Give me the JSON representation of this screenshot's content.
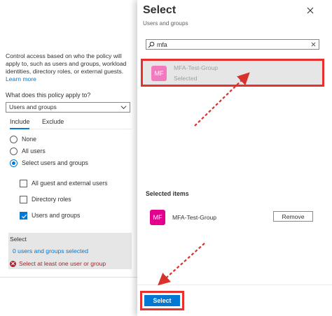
{
  "policy_pane": {
    "description": "Control access based on who the policy will apply to, such as users and groups, workload identities, directory roles, or external guests.",
    "learn_more": "Learn more",
    "question": "What does this policy apply to?",
    "applies_value": "Users and groups",
    "tabs": [
      {
        "label": "Include",
        "selected": true
      },
      {
        "label": "Exclude",
        "selected": false
      }
    ],
    "radios": [
      {
        "label": "None",
        "checked": false
      },
      {
        "label": "All users",
        "checked": false
      },
      {
        "label": "Select users and groups",
        "checked": true
      }
    ],
    "checkboxes": [
      {
        "label": "All guest and external users",
        "checked": false
      },
      {
        "label": "Directory roles",
        "checked": false
      },
      {
        "label": "Users and groups",
        "checked": true
      }
    ],
    "select_section": {
      "title": "Select",
      "link": "0 users and groups selected",
      "error": "Select at least one user or group"
    }
  },
  "select_panel": {
    "title": "Select",
    "subtitle": "Users and groups",
    "search_value": "mfa",
    "result": {
      "initials": "MF",
      "name": "MFA-Test-Group",
      "status": "Selected"
    },
    "selected_items_title": "Selected items",
    "selected_item": {
      "initials": "MF",
      "name": "MFA-Test-Group",
      "action": "Remove"
    },
    "select_button": "Select"
  },
  "colors": {
    "accent": "#0078d4",
    "highlight": "#e8312f",
    "error": "#a4262c",
    "avatar_dim": "#f27bbf",
    "avatar": "#e3008c"
  },
  "icons": [
    "chevron-down-icon",
    "close-icon",
    "search-icon",
    "clear-icon",
    "error-icon",
    "checkmark-icon",
    "arrow-annotation"
  ]
}
